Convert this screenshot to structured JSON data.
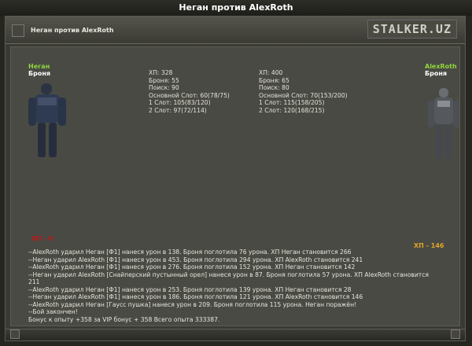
{
  "page": {
    "title": "Неган против AlexRoth"
  },
  "window": {
    "subtitle": "Неган против AlexRoth",
    "logo": "STALKER.UZ"
  },
  "left_fighter": {
    "name": "Неган",
    "armor_label": "Броня",
    "stats": [
      "ХП: 328",
      "Броня: 55",
      "Поиск: 90",
      "Основной Слот: 60(78/75)",
      "1 Слот: 105(83/120)",
      "2 Слот: 97(72/114)"
    ],
    "hp_result": "ХП - 0"
  },
  "right_fighter": {
    "name": "AlexRoth",
    "armor_label": "Броня",
    "stats": [
      "ХП: 400",
      "Броня: 65",
      "Поиск: 80",
      "Основной Слот: 70(153/200)",
      "1 Слот: 115(158/205)",
      "2 Слот: 120(168/215)"
    ],
    "hp_result": "ХП - 146"
  },
  "battle_log": [
    "--AlexRoth ударил Неган [Ф1] нанеся урон в 138. Броня поглотила 76 урона. ХП Неган становится 266",
    "--Неган ударил AlexRoth [Ф1] нанеся урон в 453. Броня поглотила 294 урона. ХП AlexRoth становится 241",
    "--AlexRoth ударил Неган [Ф1] нанеся урон в 276. Броня поглотила 152 урона. ХП Неган становится 142",
    "--Неган ударил AlexRoth [Снайперский пустынный орел] нанеся урон в 87. Броня поглотила 57 урона. ХП AlexRoth становится 211",
    "--AlexRoth ударил Неган [Ф1] нанеся урон в 253. Броня поглотила 139 урона. ХП Неган становится 28",
    "--Неган ударил AlexRoth [Ф1] нанеся урон в 186. Броня поглотила 121 урона. ХП AlexRoth становится 146",
    "--AlexRoth ударил Неган [Гаусс пушка] нанеся урон в 209. Броня поглотила 115 урона. Неган поражён!",
    "--Бой закончен!",
    "Бонус к опыту +358 за VIP бонус + 358 Всего опыта 333387."
  ]
}
